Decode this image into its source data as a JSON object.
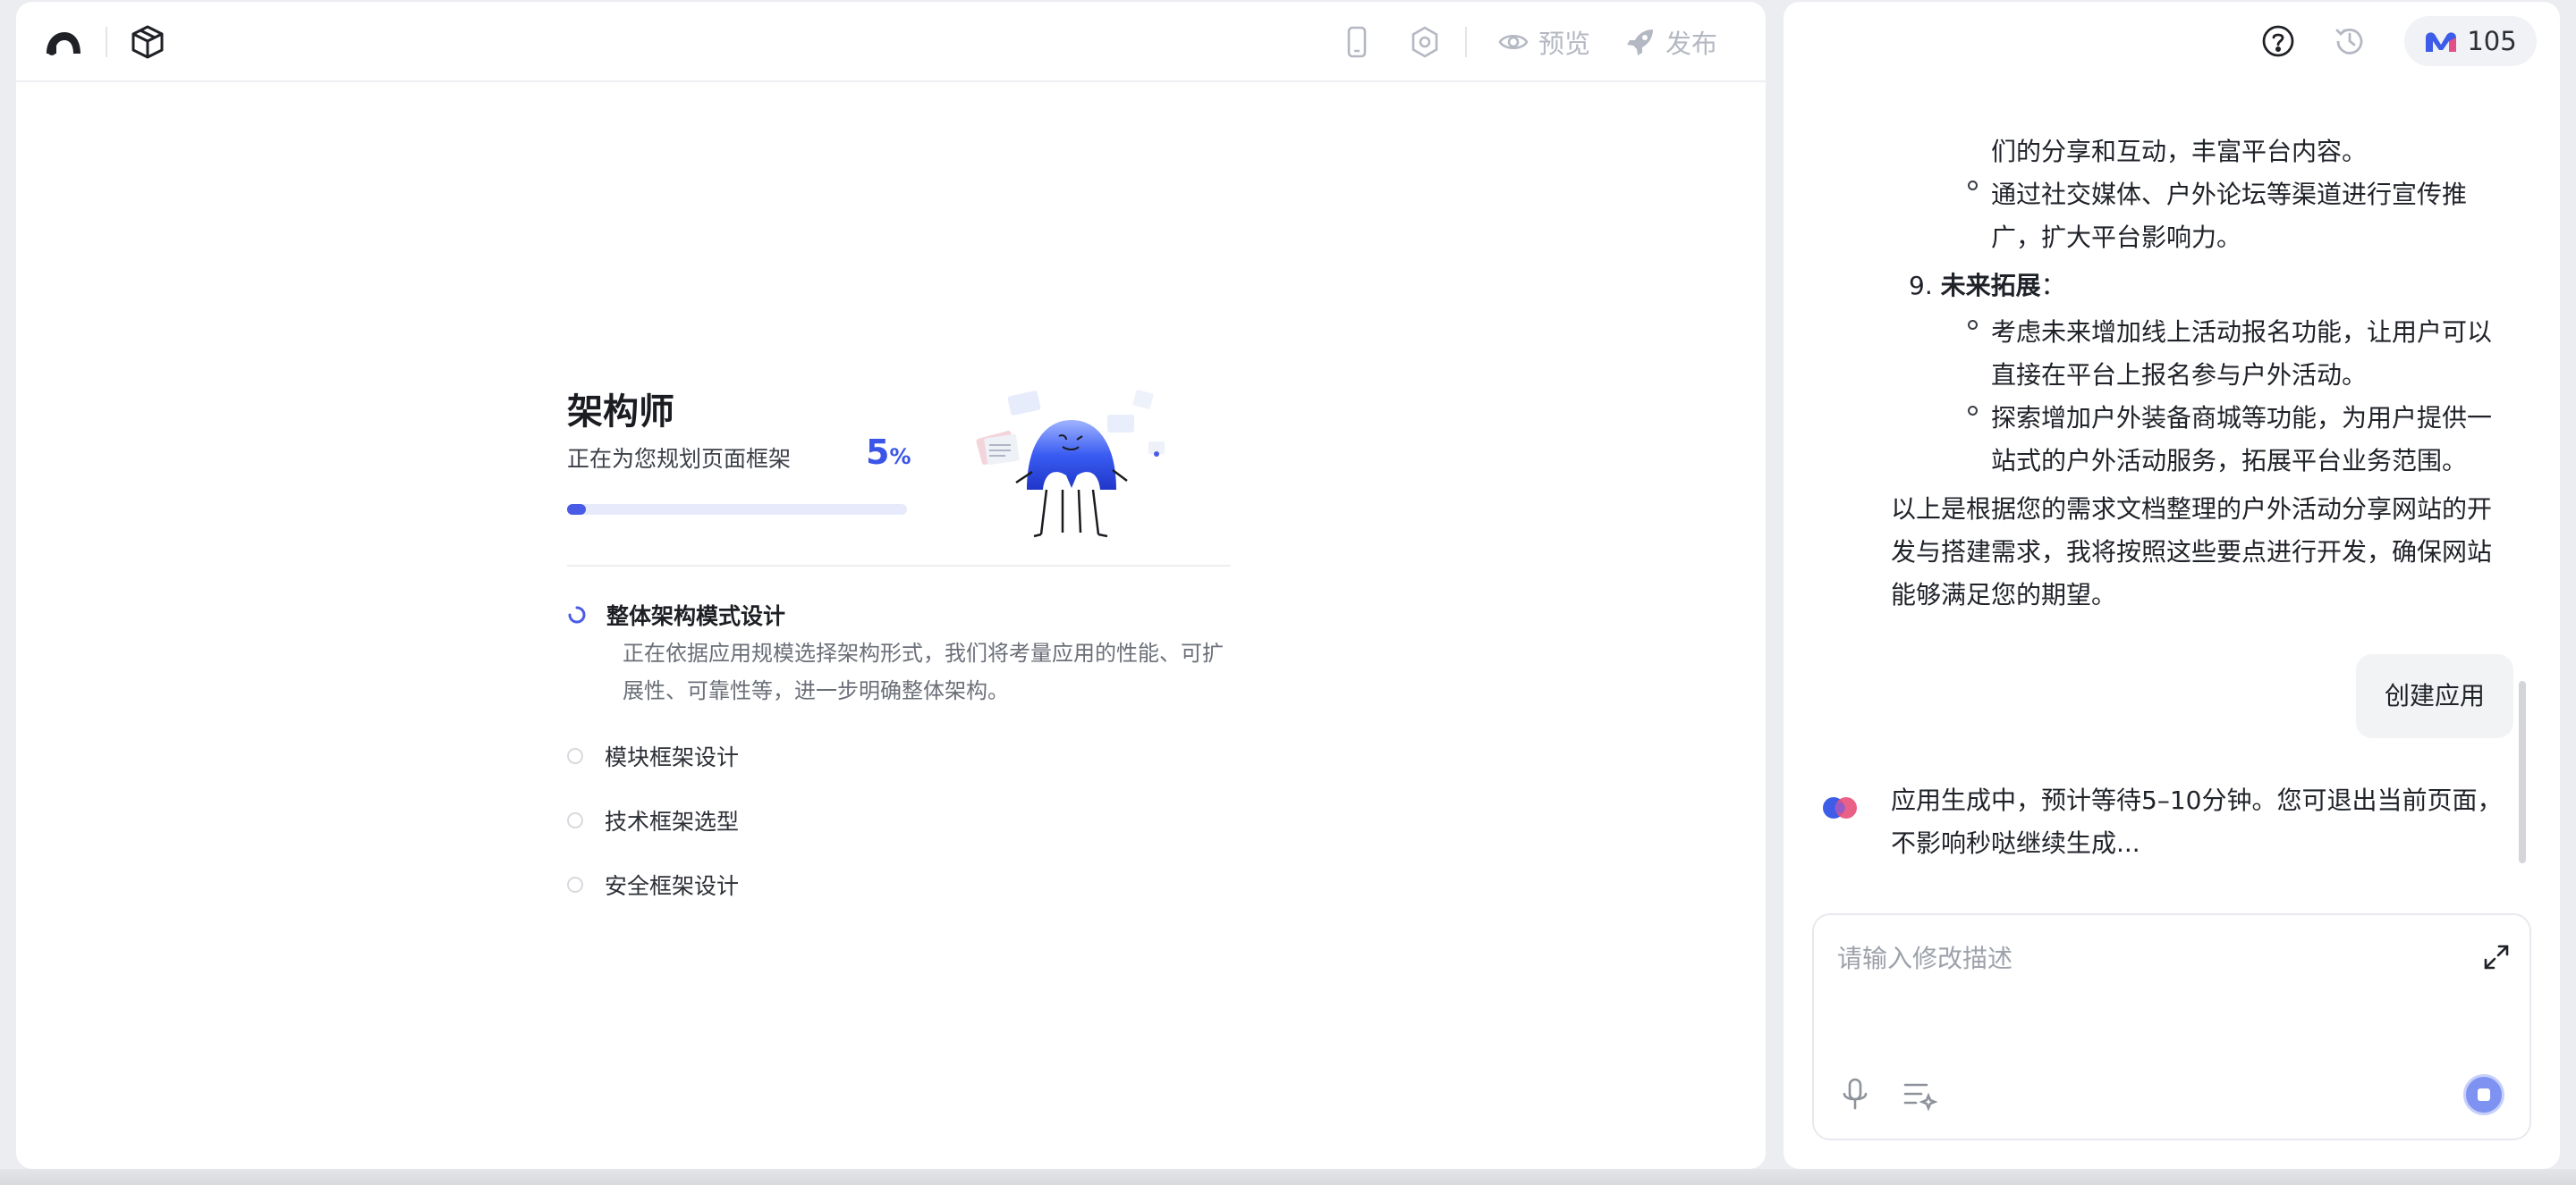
{
  "topbar": {
    "preview_label": "预览",
    "publish_label": "发布"
  },
  "architect": {
    "title": "架构师",
    "subtitle": "正在为您规划页面框架",
    "percent": "5",
    "percent_sign": "%",
    "progress": 0.05,
    "steps": [
      {
        "label": "整体架构模式设计",
        "status": "in-progress",
        "description": "正在依据应用规模选择架构形式，我们将考量应用的性能、可扩展性、可靠性等，进一步明确整体架构。"
      },
      {
        "label": "模块框架设计",
        "status": "pending"
      },
      {
        "label": "技术框架选型",
        "status": "pending"
      },
      {
        "label": "安全框架设计",
        "status": "pending"
      }
    ]
  },
  "header_right": {
    "credits": "105"
  },
  "chat": {
    "partial_lines": [
      "们的分享和互动，丰富平台内容。"
    ],
    "bullet_promo": [
      "通过社交媒体、户外论坛等渠道进行宣传推",
      "广，扩大平台影响力。"
    ],
    "item9_number": "9.",
    "item9_title": "未来拓展",
    "item9_colon": "：",
    "bullet_future1": [
      "考虑未来增加线上活动报名功能，让用户可以",
      "直接在平台上报名参与户外活动。"
    ],
    "bullet_future2": [
      "探索增加户外装备商城等功能，为用户提供一",
      "站式的户外活动服务，拓展平台业务范围。"
    ],
    "summary": [
      "以上是根据您的需求文档整理的户外活动分享网站的开",
      "发与搭建需求，我将按照这些要点进行开发，确保网站",
      "能够满足您的期望。"
    ],
    "user_message": "创建应用",
    "ai_message": [
      "应用生成中，预计等待5–10分钟。您可退出当前页面，",
      "不影响秒哒继续生成..."
    ]
  },
  "input": {
    "placeholder": "请输入修改描述",
    "value": ""
  }
}
